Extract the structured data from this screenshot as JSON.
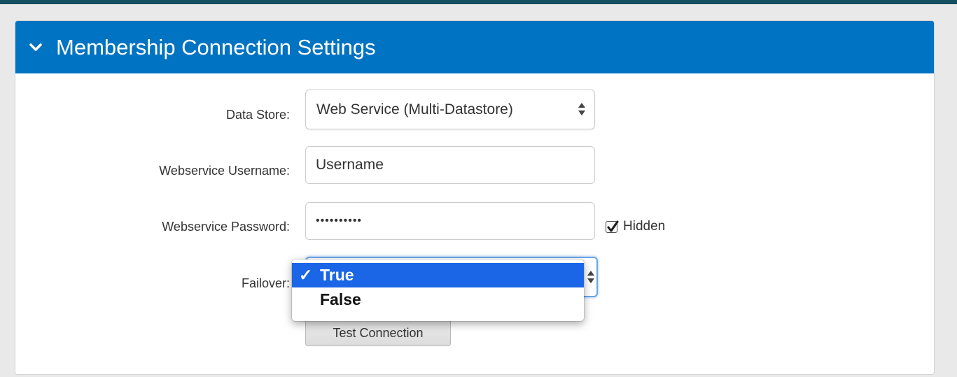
{
  "panel": {
    "title": "Membership Connection Settings",
    "header_color": "#0073c2",
    "header_icon": "chevron-down-icon"
  },
  "form": {
    "data_store": {
      "label": "Data Store:",
      "value": "Web Service (Multi-Datastore)"
    },
    "username": {
      "label": "Webservice Username:",
      "value": "Username"
    },
    "password": {
      "label": "Webservice Password:",
      "value": "••••••••••"
    },
    "hidden": {
      "label": "Hidden",
      "checked": true
    },
    "failover": {
      "label": "Failover:",
      "value": "True",
      "options": [
        {
          "label": "True",
          "check": "✓",
          "selected": true
        },
        {
          "label": "False",
          "check": "",
          "selected": false
        }
      ]
    },
    "test_button": {
      "label": "Test Connection"
    }
  }
}
